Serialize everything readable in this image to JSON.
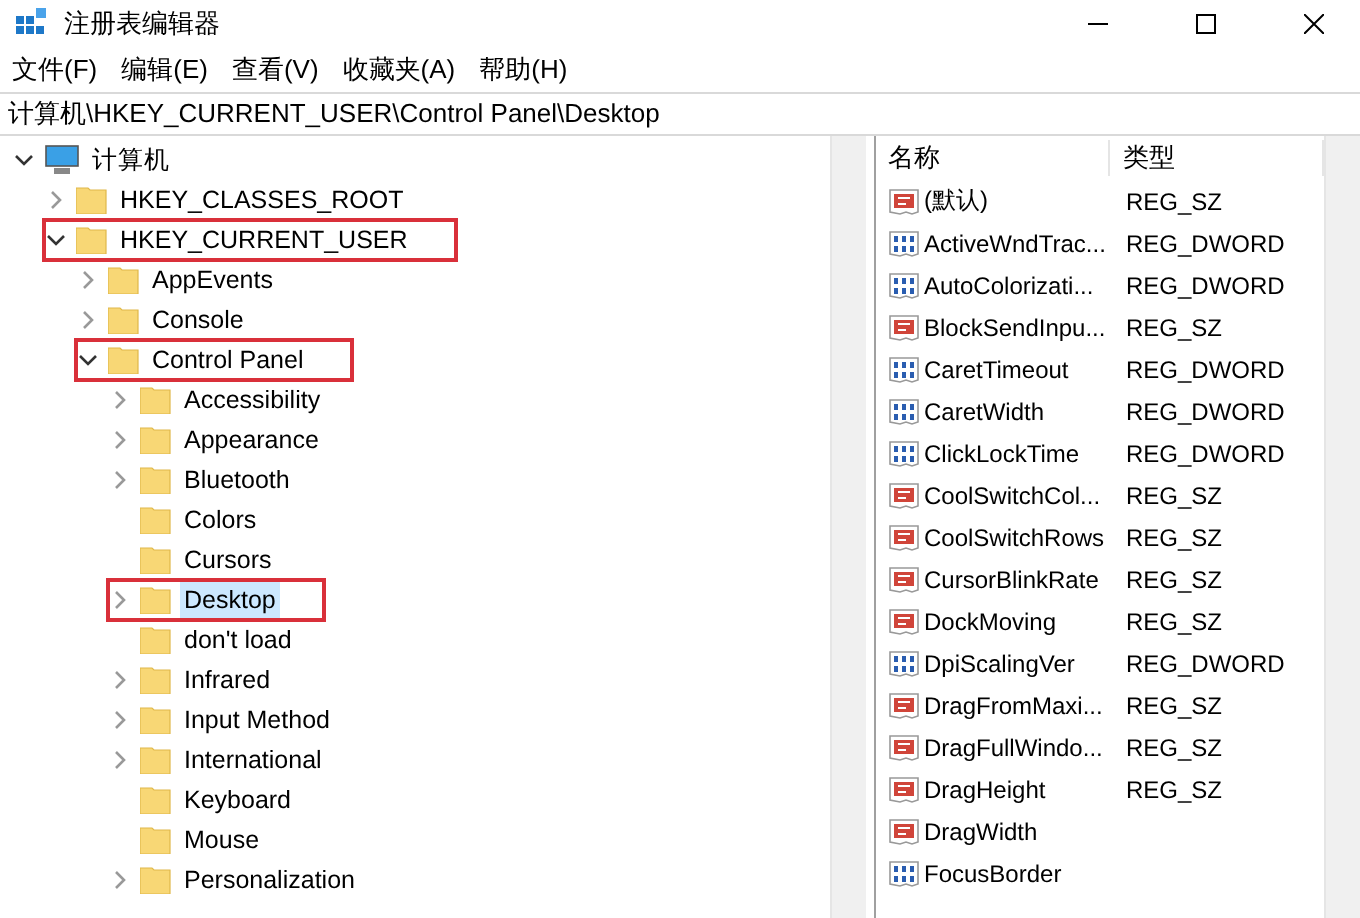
{
  "window": {
    "title": "注册表编辑器"
  },
  "menu": [
    "文件(F)",
    "编辑(E)",
    "查看(V)",
    "收藏夹(A)",
    "帮助(H)"
  ],
  "address": "计算机\\HKEY_CURRENT_USER\\Control Panel\\Desktop",
  "tree": [
    {
      "label": "计算机",
      "kind": "computer",
      "expandable": true,
      "expanded": true,
      "selected": false,
      "highlighted": false,
      "children": [
        {
          "label": "HKEY_CLASSES_ROOT",
          "kind": "folder",
          "expandable": true,
          "expanded": false,
          "selected": false,
          "highlighted": false
        },
        {
          "label": "HKEY_CURRENT_USER",
          "kind": "folder",
          "expandable": true,
          "expanded": true,
          "selected": false,
          "highlighted": true,
          "children": [
            {
              "label": "AppEvents",
              "kind": "folder",
              "expandable": true,
              "expanded": false,
              "selected": false,
              "highlighted": false
            },
            {
              "label": "Console",
              "kind": "folder",
              "expandable": true,
              "expanded": false,
              "selected": false,
              "highlighted": false
            },
            {
              "label": "Control Panel",
              "kind": "folder",
              "expandable": true,
              "expanded": true,
              "selected": false,
              "highlighted": true,
              "children": [
                {
                  "label": "Accessibility",
                  "kind": "folder",
                  "expandable": true,
                  "expanded": false,
                  "selected": false,
                  "highlighted": false
                },
                {
                  "label": "Appearance",
                  "kind": "folder",
                  "expandable": true,
                  "expanded": false,
                  "selected": false,
                  "highlighted": false
                },
                {
                  "label": "Bluetooth",
                  "kind": "folder",
                  "expandable": true,
                  "expanded": false,
                  "selected": false,
                  "highlighted": false
                },
                {
                  "label": "Colors",
                  "kind": "folder",
                  "expandable": false,
                  "selected": false,
                  "highlighted": false
                },
                {
                  "label": "Cursors",
                  "kind": "folder",
                  "expandable": false,
                  "selected": false,
                  "highlighted": false
                },
                {
                  "label": "Desktop",
                  "kind": "folder",
                  "expandable": true,
                  "expanded": false,
                  "selected": true,
                  "highlighted": true
                },
                {
                  "label": "don't load",
                  "kind": "folder",
                  "expandable": false,
                  "selected": false,
                  "highlighted": false
                },
                {
                  "label": "Infrared",
                  "kind": "folder",
                  "expandable": true,
                  "expanded": false,
                  "selected": false,
                  "highlighted": false
                },
                {
                  "label": "Input Method",
                  "kind": "folder",
                  "expandable": true,
                  "expanded": false,
                  "selected": false,
                  "highlighted": false
                },
                {
                  "label": "International",
                  "kind": "folder",
                  "expandable": true,
                  "expanded": false,
                  "selected": false,
                  "highlighted": false
                },
                {
                  "label": "Keyboard",
                  "kind": "folder",
                  "expandable": false,
                  "selected": false,
                  "highlighted": false
                },
                {
                  "label": "Mouse",
                  "kind": "folder",
                  "expandable": false,
                  "selected": false,
                  "highlighted": false
                },
                {
                  "label": "Personalization",
                  "kind": "folder",
                  "expandable": true,
                  "expanded": false,
                  "selected": false,
                  "highlighted": false
                }
              ]
            }
          ]
        }
      ]
    }
  ],
  "values": {
    "columns": [
      "名称",
      "类型"
    ],
    "rows": [
      {
        "kind": "string",
        "name": "(默认)",
        "type": "REG_SZ"
      },
      {
        "kind": "dword",
        "name": "ActiveWndTrac...",
        "type": "REG_DWORD"
      },
      {
        "kind": "dword",
        "name": "AutoColorizati...",
        "type": "REG_DWORD"
      },
      {
        "kind": "string",
        "name": "BlockSendInpu...",
        "type": "REG_SZ"
      },
      {
        "kind": "dword",
        "name": "CaretTimeout",
        "type": "REG_DWORD"
      },
      {
        "kind": "dword",
        "name": "CaretWidth",
        "type": "REG_DWORD"
      },
      {
        "kind": "dword",
        "name": "ClickLockTime",
        "type": "REG_DWORD"
      },
      {
        "kind": "string",
        "name": "CoolSwitchCol...",
        "type": "REG_SZ"
      },
      {
        "kind": "string",
        "name": "CoolSwitchRows",
        "type": "REG_SZ"
      },
      {
        "kind": "string",
        "name": "CursorBlinkRate",
        "type": "REG_SZ"
      },
      {
        "kind": "string",
        "name": "DockMoving",
        "type": "REG_SZ"
      },
      {
        "kind": "dword",
        "name": "DpiScalingVer",
        "type": "REG_DWORD"
      },
      {
        "kind": "string",
        "name": "DragFromMaxi...",
        "type": "REG_SZ"
      },
      {
        "kind": "string",
        "name": "DragFullWindo...",
        "type": "REG_SZ"
      },
      {
        "kind": "string",
        "name": "DragHeight",
        "type": "REG_SZ"
      },
      {
        "kind": "string",
        "name": "DragWidth"
      },
      {
        "kind": "dword",
        "name": "FocusBorder"
      }
    ]
  }
}
